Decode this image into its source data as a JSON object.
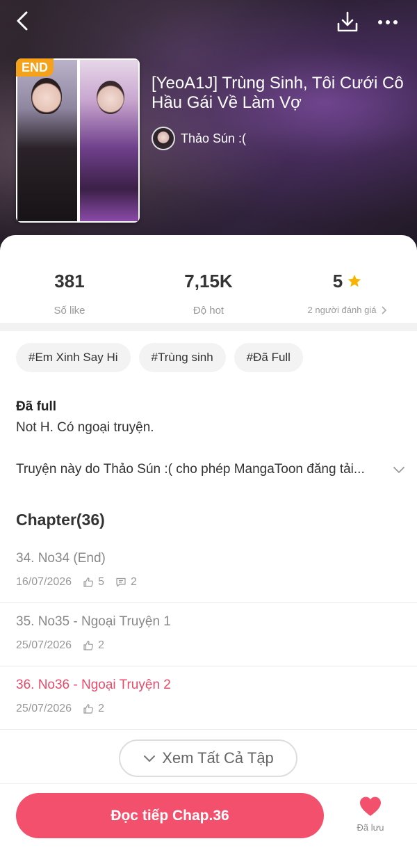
{
  "header": {
    "end_badge": "END",
    "title": "[YeoA1J] Trùng Sinh, Tôi Cưới Cô Hầu Gái Về Làm Vợ",
    "author": "Thảo Sún :("
  },
  "stats": {
    "likes": {
      "value": "381",
      "label": "Số like"
    },
    "hot": {
      "value": "7,15K",
      "label": "Độ hot"
    },
    "rating": {
      "value": "5",
      "label": "2 người đánh giá"
    }
  },
  "tags": [
    "#Em Xinh Say Hi",
    "#Trùng sinh",
    "#Đã Full"
  ],
  "description": {
    "heading": "Đã full",
    "line1": "Not H. Có ngoại truyện.",
    "line2": "Truyện này do Thảo Sún :( cho phép MangaToon đăng tải..."
  },
  "chapters": {
    "heading": "Chapter(36)",
    "items": [
      {
        "name": "34. No34 (End)",
        "date": "16/07/2026",
        "likes": "5",
        "comments": "2"
      },
      {
        "name": "35. No35 - Ngoại Truyện 1",
        "date": "25/07/2026",
        "likes": "2"
      },
      {
        "name": "36. No36 - Ngoại Truyện 2",
        "date": "25/07/2026",
        "likes": "2"
      }
    ],
    "view_all": "Xem Tất Cả Tập"
  },
  "bottom": {
    "read_button": "Đọc tiếp Chap.36",
    "saved_label": "Đã lưu"
  },
  "colors": {
    "accent": "#f2506c",
    "active_chapter": "#e84b6a",
    "end_badge": "#f4a11b",
    "star": "#f6b400"
  },
  "icons": [
    "back-icon",
    "download-icon",
    "more-icon",
    "star-icon",
    "chevron-right-icon",
    "chevron-down-icon",
    "thumbs-up-icon",
    "comment-icon",
    "heart-icon"
  ]
}
